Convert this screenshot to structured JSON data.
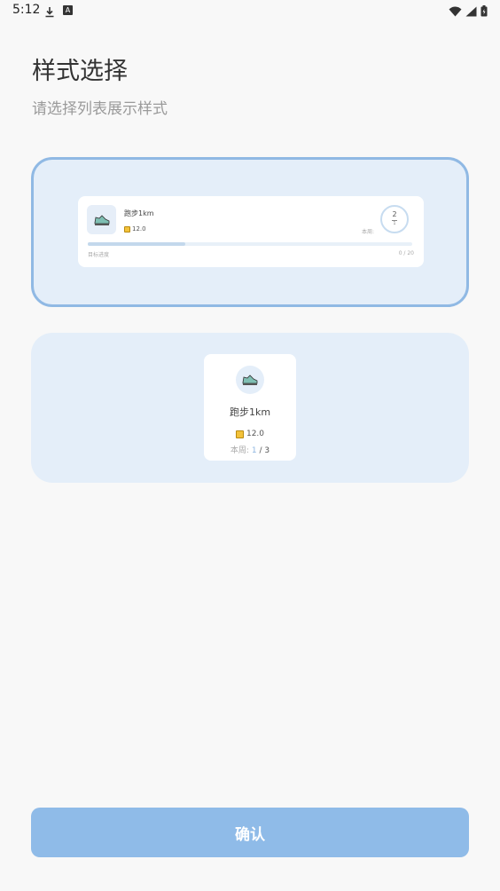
{
  "status_bar": {
    "time": "5:12",
    "a_badge": "A"
  },
  "page": {
    "title": "样式选择",
    "subtitle": "请选择列表展示样式"
  },
  "option_list": {
    "selected": true,
    "name": "跑步1km",
    "coins": "12.0",
    "week_label": "本周:",
    "ring_top": "2",
    "ring_bottom": "1",
    "goal_label": "目标进度",
    "count": "0 / 20",
    "progress": 0.3
  },
  "option_grid": {
    "selected": false,
    "name": "跑步1km",
    "coins": "12.0",
    "week_label": "本周:",
    "week_current": "1",
    "week_total": "/ 3"
  },
  "confirm_label": "确认",
  "colors": {
    "accent": "#8fbbe8",
    "selected_border": "#90b9e4",
    "option_bg": "#e4eef9"
  }
}
